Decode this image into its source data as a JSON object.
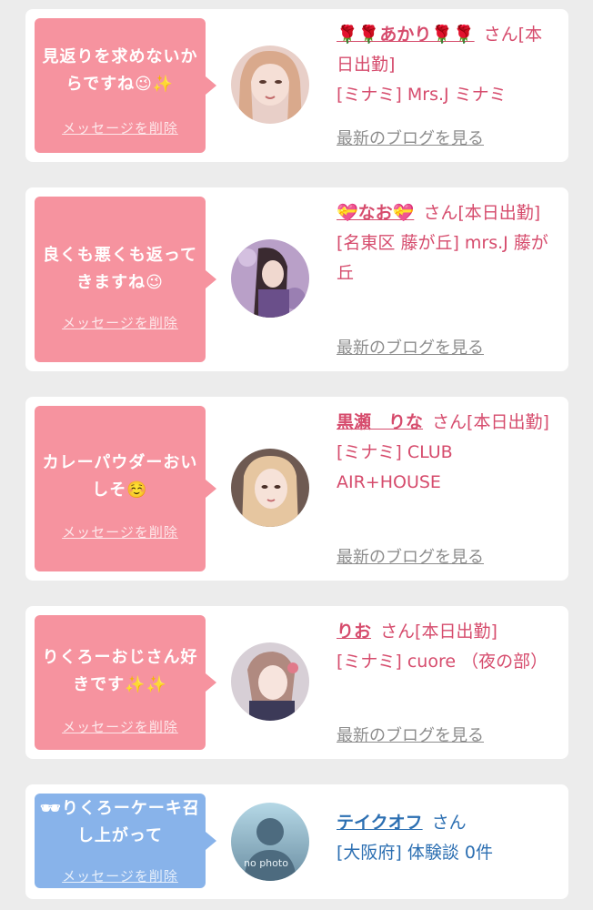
{
  "cards": [
    {
      "message": "見返りを求めないからですね😉✨",
      "delete_label": "メッセージを削除",
      "name": "🌹🌹あかり🌹🌹",
      "san": "さん",
      "status": "[本日出勤]",
      "shop": "[ミナミ] Mrs.J ミナミ",
      "blog": "最新のブログを見る"
    },
    {
      "message": "良くも悪くも返ってきますね😉",
      "delete_label": "メッセージを削除",
      "name": "💝なお💝",
      "san": "さん",
      "status": "[本日出勤]",
      "shop": "[名東区 藤が丘] mrs.J 藤が丘",
      "blog": "最新のブログを見る"
    },
    {
      "message": "カレーパウダーおいしそ☺️",
      "delete_label": "メッセージを削除",
      "name": "黒瀬　りな",
      "san": "さん",
      "status": "[本日出勤]",
      "shop": "[ミナミ] CLUB AIR+HOUSE",
      "blog": "最新のブログを見る"
    },
    {
      "message": "りくろーおじさん好きです✨✨",
      "delete_label": "メッセージを削除",
      "name": "りお",
      "san": "さん",
      "status": "[本日出勤]",
      "shop": "[ミナミ] cuore （夜の部）",
      "blog": "最新のブログを見る"
    },
    {
      "message": "🕶りくろーケーキ召し上がって",
      "delete_label": "メッセージを削除",
      "name": "テイクオフ",
      "san": "さん",
      "area": "[大阪府] 体験談 0件",
      "avatar_text": "no photo"
    }
  ],
  "colors": {
    "accent_pink": "#f6939f",
    "accent_blue": "#88b3ea",
    "name_pink": "#d64c6d",
    "name_blue": "#2c6fb2"
  }
}
